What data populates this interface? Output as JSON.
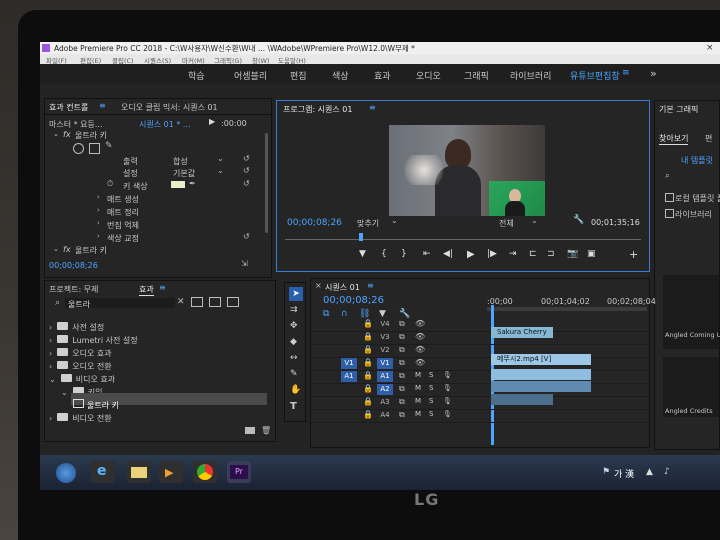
{
  "titlebar": {
    "title": "Adobe Premiere Pro CC 2018 - C:\\W사용자\\W신수환\\W내 ... \\WAdobe\\WPremiere Pro\\W12.0\\W무제 *"
  },
  "menubar": {
    "items": [
      "파일(F)",
      "편집(E)",
      "클립(C)",
      "시퀀스(S)",
      "마커(M)",
      "그래픽(G)",
      "창(W)",
      "도움말(H)"
    ]
  },
  "workspaces": {
    "items": [
      "학습",
      "어셈블리",
      "편집",
      "색상",
      "효과",
      "오디오",
      "그래픽",
      "라이브러리",
      "유튜브편집창"
    ],
    "active": "유튜브편집창",
    "more": "»"
  },
  "effect_controls": {
    "tab": "효과 컨트롤",
    "tab2": "오디오 클립 믹서: 시퀀스 01",
    "master": "마스터 * 요등...",
    "sequence": "시퀀스 01 * ...",
    "ruler_time": ":00:00",
    "effect_name": "울트라 키",
    "props": [
      {
        "label": "출력",
        "value": "합성"
      },
      {
        "label": "설정",
        "value": "기본값"
      },
      {
        "label": "키 색상",
        "value": ""
      }
    ],
    "groups": [
      "매트 생성",
      "매트 정리",
      "번짐 억제",
      "색상 교정"
    ],
    "effect2": "울트라 키",
    "timecode": "00;00;08;26"
  },
  "program": {
    "title": "프로그램: 시퀀스 01",
    "timecode": "00;00;08;26",
    "fit": "맞추기",
    "quality": "전체",
    "duration": "00;01;35;16"
  },
  "essential": {
    "title": "기본 그래픽",
    "tab": "찾아보기",
    "tab2": "편",
    "my_templates": "내 템플릿",
    "check1": "로컬 템플릿 폴",
    "check2": "라이브러리",
    "thumb1": "Angled Coming Up",
    "thumb2": "Angled Credits"
  },
  "project": {
    "tab": "프로젝트: 무제",
    "tab2": "효과",
    "search": "울트라",
    "tree": [
      {
        "label": "사전 설정",
        "indent": 0
      },
      {
        "label": "Lumetri 사전 설정",
        "indent": 0
      },
      {
        "label": "오디오 효과",
        "indent": 0
      },
      {
        "label": "오디오 전환",
        "indent": 0
      },
      {
        "label": "비디오 효과",
        "indent": 0
      },
      {
        "label": "키잉",
        "indent": 1
      },
      {
        "label": "울트라 키",
        "indent": 2
      },
      {
        "label": "비디오 전환",
        "indent": 0
      }
    ]
  },
  "timeline": {
    "tab": "시퀀스 01",
    "timecode": "00;00;08;26",
    "ruler": [
      ":00;00",
      "00;01;04;02",
      "00;02;08;04"
    ],
    "tracks": [
      {
        "name": "V4",
        "src": "",
        "tgt": ""
      },
      {
        "name": "V3",
        "src": "",
        "tgt": ""
      },
      {
        "name": "V2",
        "src": "",
        "tgt": ""
      },
      {
        "name": "V1",
        "src": "V1",
        "tgt": "V1"
      },
      {
        "name": "A1",
        "src": "A1",
        "tgt": "A1"
      },
      {
        "name": "A2",
        "src": "",
        "tgt": "A2"
      },
      {
        "name": "A3",
        "src": "",
        "tgt": ""
      },
      {
        "name": "A4",
        "src": "",
        "tgt": ""
      }
    ],
    "clips": [
      "Sakura Cherry Bl",
      "메뚜시2.mp4 [V]"
    ],
    "track_icons": [
      "M",
      "S"
    ]
  },
  "taskbar": {
    "ime": "가 漢",
    "brand": "LG"
  }
}
